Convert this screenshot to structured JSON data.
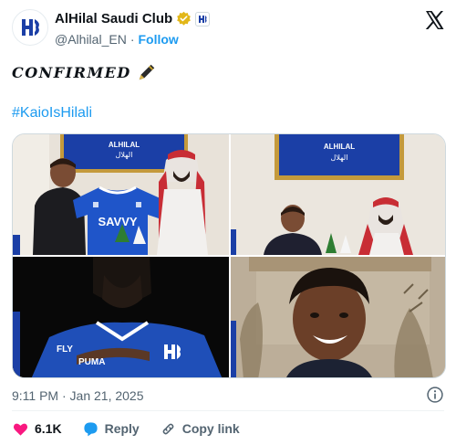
{
  "author": {
    "display_name": "AlHilal Saudi Club",
    "handle": "@Alhilal_EN",
    "separator": "·",
    "follow_label": "Follow",
    "avatar_icon": "alhilal-logo-icon",
    "verified_color": "#e2b719"
  },
  "post": {
    "text_line1": "CONFIRMED",
    "text_emoji": "pen-icon",
    "hashtag": "#KaioIsHilali",
    "timestamp": "9:11 PM · Jan 21, 2025"
  },
  "media": {
    "photo1": {
      "board_text_top": "ALHILAL",
      "board_text_bottom": "الهلال",
      "shirt_sponsor": "SAVVY"
    },
    "photo2": {
      "board_text_top": "ALHILAL",
      "board_text_bottom": "الهلال"
    },
    "photo3": {
      "shirt_sponsor": "FLY",
      "shirt_brand": "PUMA"
    },
    "photo4": {}
  },
  "actions": {
    "like_count": "6.1K",
    "reply_label": "Reply",
    "copy_label": "Copy link"
  },
  "colors": {
    "accent": "#1d9bf0",
    "like": "#f91880",
    "club_blue": "#1b3fa6"
  }
}
